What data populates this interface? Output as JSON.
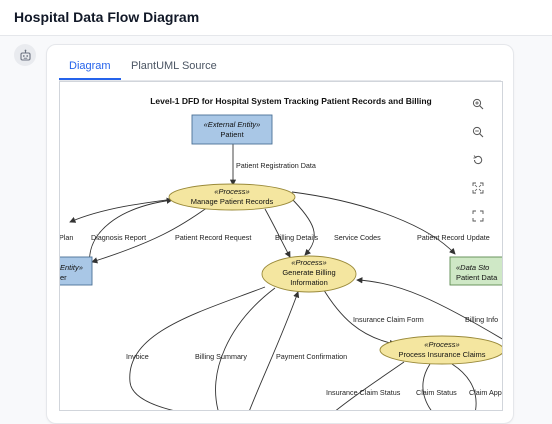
{
  "app": {
    "title": "Hospital Data Flow Diagram"
  },
  "tabs": [
    {
      "label": "Diagram"
    },
    {
      "label": "PlantUML Source"
    }
  ],
  "diagram": {
    "title": "Level-1 DFD for Hospital System Tracking Patient Records and Billing",
    "nodes": {
      "patient": {
        "stereo": "«External Entity»",
        "label": "Patient"
      },
      "manage": {
        "stereo": "«Process»",
        "label": "Manage Patient Records"
      },
      "billing": {
        "stereo": "«Process»",
        "label1": "Generate Billing",
        "label2": "Information"
      },
      "claims": {
        "stereo": "«Process»",
        "label": "Process Insurance Claims"
      },
      "left_entity": {
        "stereo": "Entity»",
        "label": "er"
      },
      "datastore": {
        "stereo": "«Data Sto",
        "label": "Patient Data"
      }
    },
    "edges": {
      "patient_registration": "Patient Registration Data",
      "plan": "Plan",
      "diagnosis_report": "Diagnosis Report",
      "patient_record_request": "Patient Record Request",
      "billing_details": "Billing Details",
      "service_codes": "Service Codes",
      "patient_record_update": "Patient Record Update",
      "insurance_claim_form": "Insurance Claim Form",
      "billing_info": "Billing Info",
      "invoice": "Invoice",
      "billing_summary": "Billing Summary",
      "payment_confirmation": "Payment Confirmation",
      "insurance_claim_status": "Insurance Claim Status",
      "claim_status": "Claim Status",
      "claim_app": "Claim App"
    }
  },
  "controls": [
    "zoom-in-icon",
    "zoom-out-icon",
    "reset-icon",
    "fit-icon",
    "fullscreen-icon"
  ]
}
